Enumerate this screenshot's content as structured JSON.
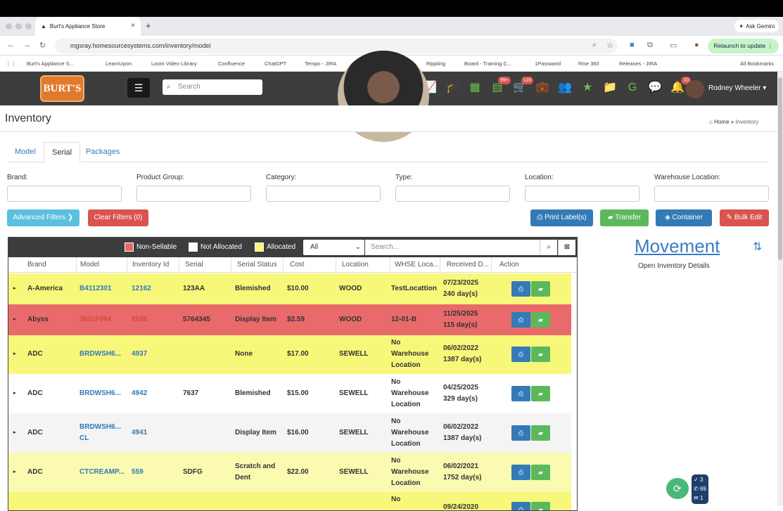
{
  "browser": {
    "tab_title": "Burt's Appliance Store",
    "tab_close": "×",
    "new_tab": "+",
    "ask_gemini": "Ask Gemini",
    "url": "mgsray.homesourcesystems.com/inventory/model",
    "relaunch": "Relaunch to update",
    "bookmarks": [
      "Burt's Appliance S...",
      "LearnUpon",
      "Loom Video Library",
      "Confluence",
      "ChatGPT",
      "Tempo - JIRA",
      "Rippling",
      "Board - Training C...",
      "1Password",
      "Rise 360",
      "Releases - JIRA"
    ],
    "all_bookmarks": "All Bookmarks"
  },
  "header": {
    "logo": "BURT'S",
    "search_placeholder": "Search",
    "badges": {
      "b1": "99+",
      "b2": "116",
      "bell": "10"
    },
    "user": "Rodney Wheeler ▾"
  },
  "page": {
    "title": "Inventory",
    "breadcrumb_home": "Home",
    "breadcrumb_current": "Inventory",
    "tabs": [
      "Model",
      "Serial",
      "Packages"
    ],
    "filters": [
      "Brand:",
      "Product Group:",
      "Category:",
      "Type:",
      "Location:",
      "Warehouse Location:"
    ],
    "buttons": {
      "advanced": "Advanced Filters ❯",
      "clear": "Clear Filters (0)",
      "print": "Print Label(s)",
      "transfer": "Transfer",
      "container": "Container",
      "bulk": "Bulk Edit"
    }
  },
  "grid": {
    "legend": [
      "Non-Sellable",
      "Not Allocated",
      "Allocated"
    ],
    "select_value": "All",
    "search_placeholder": "Search...",
    "columns": [
      "Brand",
      "Model",
      "Inventory Id",
      "Serial",
      "Serial Status",
      "Cost",
      "Location",
      "WHSE Loca...",
      "Received D...",
      "Action"
    ],
    "rows": [
      {
        "brand": "A-America",
        "model": "B4112301",
        "id": "12162",
        "serial": "123AA",
        "status": "Blemished",
        "cost": "$10.00",
        "location": "WOOD",
        "whse": "TestLocattion",
        "received": "07/23/2025",
        "days": "240 day(s)",
        "color": "#f7f77a"
      },
      {
        "brand": "Abyss",
        "model": "3601F094",
        "id": "8535",
        "serial": "5764345",
        "status": "Display Item",
        "cost": "$2.59",
        "location": "WOOD",
        "whse": "12-01-B",
        "received": "11/25/2025",
        "days": "115 day(s)",
        "color": "#e96a6a"
      },
      {
        "brand": "ADC",
        "model": "BRDWSH6...",
        "id": "4937",
        "serial": "",
        "status": "None",
        "cost": "$17.00",
        "location": "SEWELL",
        "whse": "No Warehouse Location",
        "received": "06/02/2022",
        "days": "1387 day(s)",
        "color": "#f7f77a"
      },
      {
        "brand": "ADC",
        "model": "BRDWSH6...",
        "id": "4942",
        "serial": "7637",
        "status": "Blemished",
        "cost": "$15.00",
        "location": "SEWELL",
        "whse": "No Warehouse Location",
        "received": "04/25/2025",
        "days": "329 day(s)",
        "color": "#ffffff"
      },
      {
        "brand": "ADC",
        "model": "BRDWSH6... CL",
        "id": "4941",
        "serial": "",
        "status": "Display Item",
        "cost": "$16.00",
        "location": "SEWELL",
        "whse": "No Warehouse Location",
        "received": "06/02/2022",
        "days": "1387 day(s)",
        "color": "#f4f4f4"
      },
      {
        "brand": "ADC",
        "model": "CTCREAMP...",
        "id": "559",
        "serial": "SDFG",
        "status": "Scratch and Dent",
        "cost": "$22.00",
        "location": "SEWELL",
        "whse": "No Warehouse Location",
        "received": "06/02/2021",
        "days": "1752 day(s)",
        "color": "#fafab0"
      },
      {
        "brand": "",
        "model": "",
        "id": "",
        "serial": "",
        "status": "",
        "cost": "",
        "location": "",
        "whse": "No",
        "received": "09/24/2020",
        "days": "",
        "color": "#f7f77a"
      }
    ]
  },
  "side": {
    "movement": "Movement",
    "open_details": "Open Inventory Details"
  },
  "widget": {
    "a": "3",
    "b": "69",
    "c": "1"
  }
}
